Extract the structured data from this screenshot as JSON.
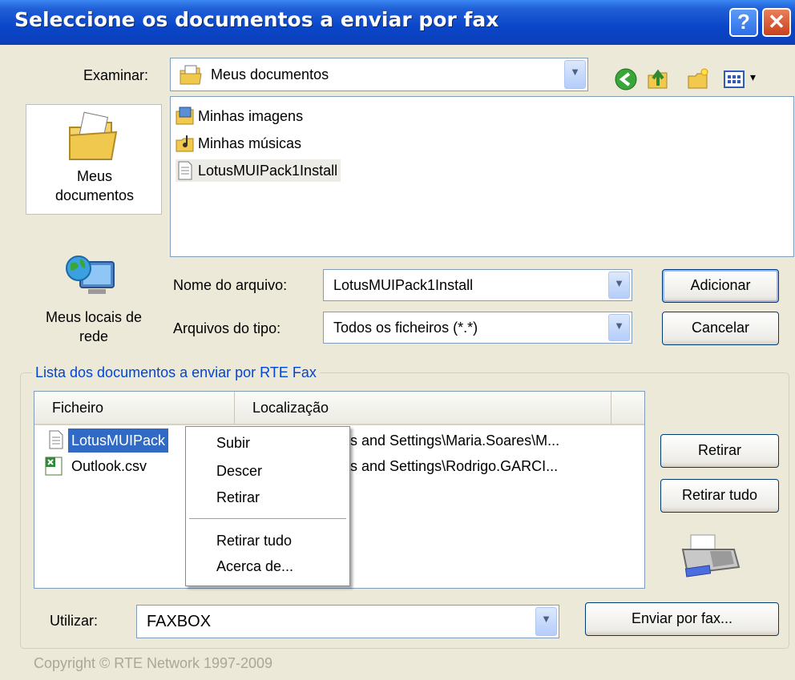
{
  "window": {
    "title": "Seleccione os documentos a enviar por fax"
  },
  "lookin": {
    "label": "Examinar:",
    "value": "Meus documentos"
  },
  "toolbar_icons": [
    "back-icon",
    "up-folder-icon",
    "new-folder-icon",
    "view-menu-icon"
  ],
  "places": [
    {
      "label_line1": "Meus",
      "label_line2": "documentos",
      "icon": "my-documents-icon"
    },
    {
      "label_line1": "Meus locais de",
      "label_line2": "rede",
      "icon": "network-places-icon"
    }
  ],
  "files": [
    {
      "name": "Minhas imagens",
      "icon": "pictures-folder-icon"
    },
    {
      "name": "Minhas músicas",
      "icon": "music-folder-icon"
    },
    {
      "name": "LotusMUIPack1Install",
      "icon": "text-file-icon"
    }
  ],
  "filename": {
    "label": "Nome do arquivo:",
    "value": "LotusMUIPack1Install"
  },
  "filetype": {
    "label": "Arquivos do tipo:",
    "value": "Todos os ficheiros (*.*)"
  },
  "buttons": {
    "add": "Adicionar",
    "cancel": "Cancelar",
    "remove": "Retirar",
    "remove_all": "Retirar tudo",
    "send": "Enviar por fax..."
  },
  "list": {
    "legend": "Lista dos documentos a enviar por RTE Fax",
    "columns": [
      "Ficheiro",
      "Localização"
    ],
    "rows": [
      {
        "file": "LotusMUIPack",
        "location": "s and Settings\\Maria.Soares\\M..."
      },
      {
        "file": "Outlook.csv",
        "location": "s and Settings\\Rodrigo.GARCI..."
      }
    ]
  },
  "context_menu": [
    "Subir",
    "Descer",
    "Retirar",
    "Retirar tudo",
    "Acerca de..."
  ],
  "use": {
    "label": "Utilizar:",
    "value": "FAXBOX"
  },
  "copyright": "Copyright © RTE Network 1997-2009",
  "colors": {
    "title_blue": "#0a46c9",
    "selection": "#316ac5",
    "legend": "#0046d5"
  }
}
